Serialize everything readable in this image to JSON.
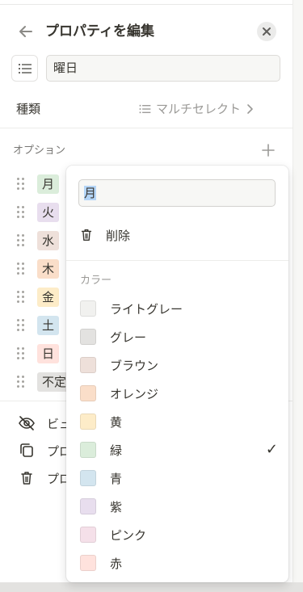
{
  "header": {
    "title": "プロパティを編集"
  },
  "property": {
    "name": "曜日",
    "type_label": "種類",
    "type_value": "マルチセレクト"
  },
  "options": {
    "label": "オプション",
    "items": [
      {
        "label": "月",
        "bg": "#dbeddb"
      },
      {
        "label": "火",
        "bg": "#e8deee"
      },
      {
        "label": "水",
        "bg": "#eee0da"
      },
      {
        "label": "木",
        "bg": "#fadec9"
      },
      {
        "label": "金",
        "bg": "#fdecc8"
      },
      {
        "label": "土",
        "bg": "#d3e5ef"
      },
      {
        "label": "日",
        "bg": "#ffe2dd"
      },
      {
        "label": "不定",
        "bg": "#e3e2e0"
      }
    ]
  },
  "bottom_menu": [
    {
      "label": "ビュ",
      "icon": "eye-slash-icon"
    },
    {
      "label": "プロ",
      "icon": "duplicate-icon"
    },
    {
      "label": "プロ",
      "icon": "trash-icon"
    }
  ],
  "option_menu": {
    "name_value": "月",
    "delete_label": "削除",
    "colors_header": "カラー",
    "colors": [
      {
        "label": "ライトグレー",
        "swatch": "#f1f1ef",
        "selected": false
      },
      {
        "label": "グレー",
        "swatch": "#e3e2e0",
        "selected": false
      },
      {
        "label": "ブラウン",
        "swatch": "#eee0da",
        "selected": false
      },
      {
        "label": "オレンジ",
        "swatch": "#fadec9",
        "selected": false
      },
      {
        "label": "黄",
        "swatch": "#fdecc8",
        "selected": false
      },
      {
        "label": "緑",
        "swatch": "#dbeddb",
        "selected": true
      },
      {
        "label": "青",
        "swatch": "#d3e5ef",
        "selected": false
      },
      {
        "label": "紫",
        "swatch": "#e8deee",
        "selected": false
      },
      {
        "label": "ピンク",
        "swatch": "#f5e0e9",
        "selected": false
      },
      {
        "label": "赤",
        "swatch": "#ffe2dd",
        "selected": false
      }
    ],
    "check_glyph": "✓"
  }
}
